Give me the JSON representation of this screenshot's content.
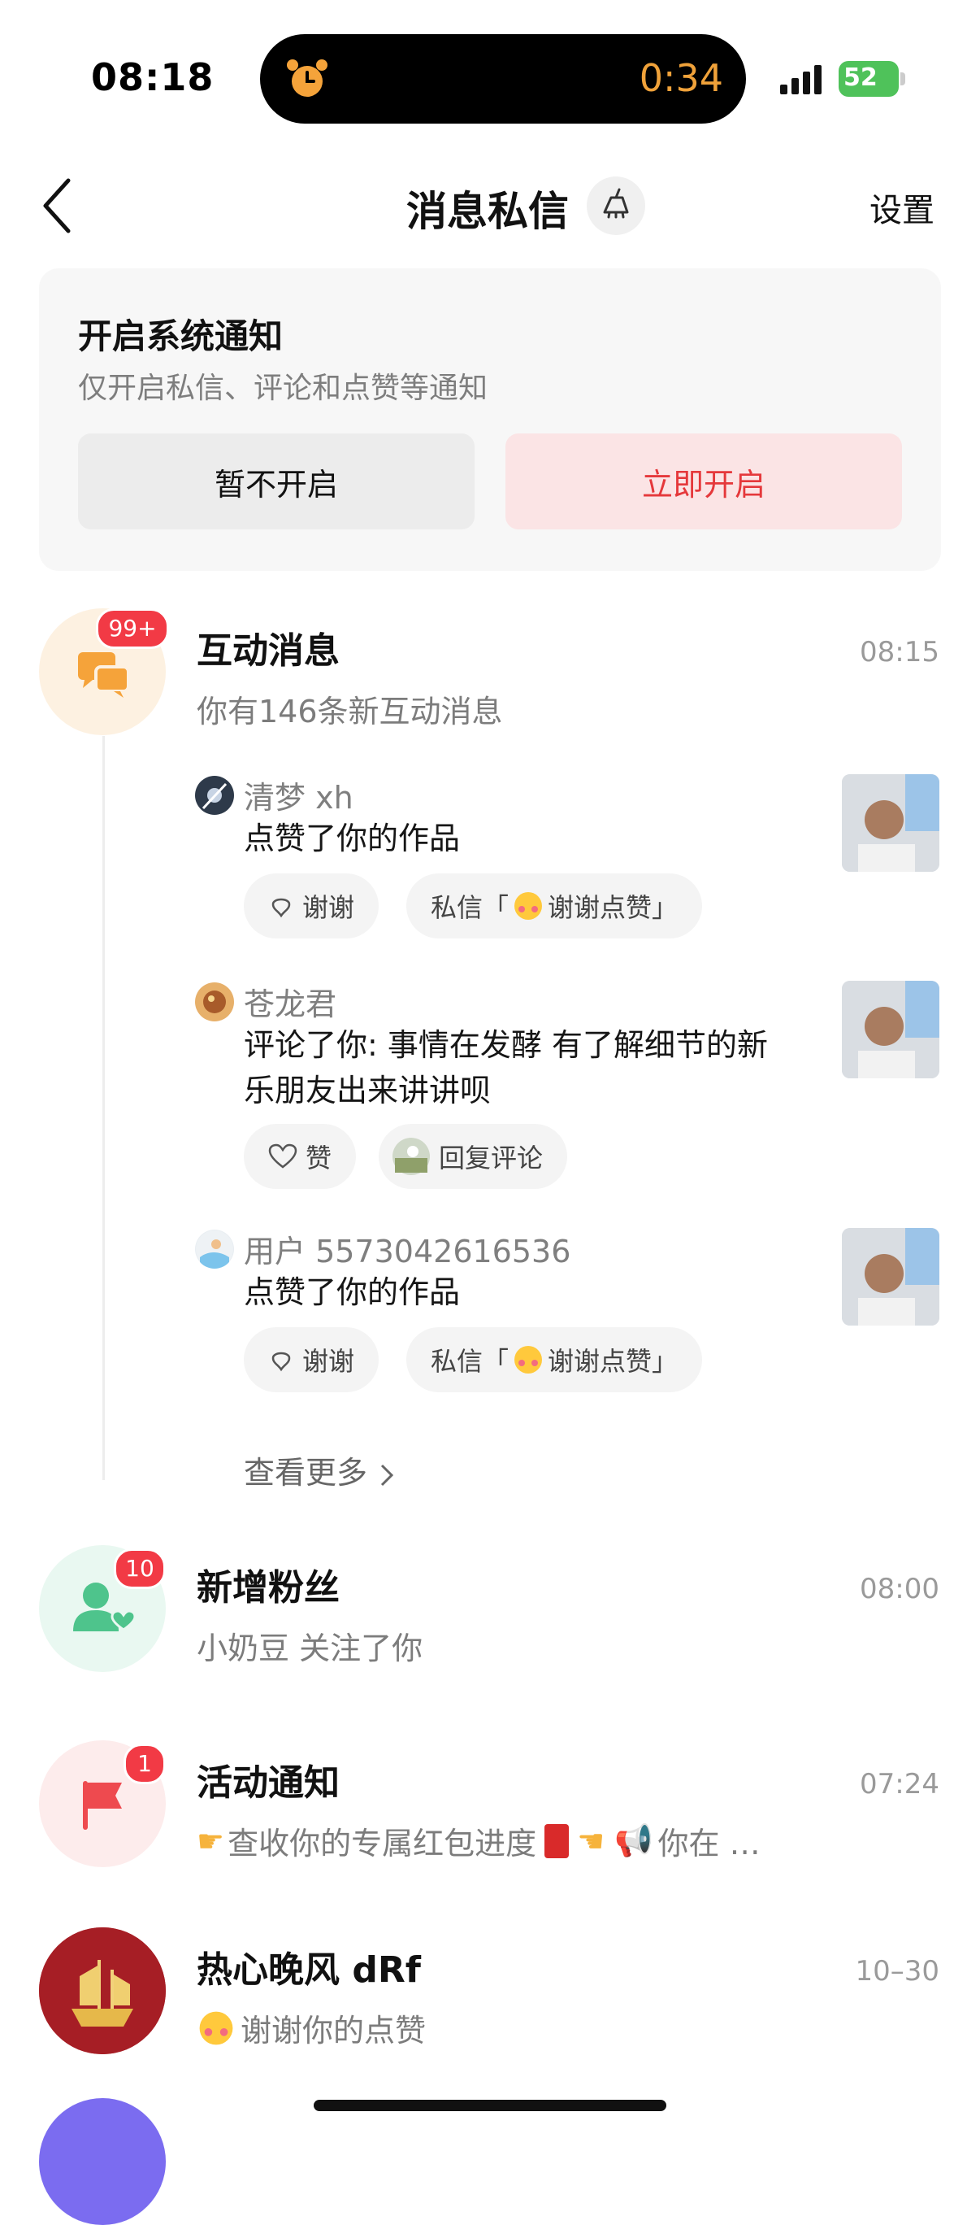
{
  "status_bar": {
    "time": "08:18",
    "timer": "0:34",
    "battery": "52"
  },
  "header": {
    "title": "消息私信",
    "settings_label": "设置"
  },
  "notification_card": {
    "title": "开启系统通知",
    "subtitle": "仅开启私信、评论和点赞等通知",
    "later_label": "暂不开启",
    "enable_label": "立即开启"
  },
  "interaction": {
    "badge": "99+",
    "title": "互动消息",
    "time": "08:15",
    "subtitle": "你有146条新互动消息",
    "items": [
      {
        "user": "清梦 xh",
        "text": "点赞了你的作品",
        "action1": "谢谢",
        "action2": "私信「",
        "action2_suffix": "谢谢点赞」"
      },
      {
        "user": "苍龙君",
        "text": "评论了你: 事情在发酵 有了解细节的新乐朋友出来讲讲呗",
        "action1": "赞",
        "action2": "回复评论"
      },
      {
        "user": "用户 5573042616536",
        "text": "点赞了你的作品",
        "action1": "谢谢",
        "action2": "私信「",
        "action2_suffix": "谢谢点赞」"
      }
    ],
    "more_label": "查看更多"
  },
  "fans": {
    "badge": "10",
    "title": "新增粉丝",
    "time": "08:00",
    "subtitle": "小奶豆 关注了你"
  },
  "activity": {
    "badge": "1",
    "title": "活动通知",
    "time": "07:24",
    "subtitle_a": "查收你的专属红包进度",
    "subtitle_b": "你在 …"
  },
  "chat": {
    "title": "热心晚风 dRf",
    "time": "10–30",
    "subtitle": "谢谢你的点赞"
  },
  "colors": {
    "accent_red": "#e5383b",
    "badge_red": "#f23a45",
    "orange_icon": "#f5a33a",
    "green_icon": "#4ec48c",
    "red_icon": "#ee4a4f"
  }
}
